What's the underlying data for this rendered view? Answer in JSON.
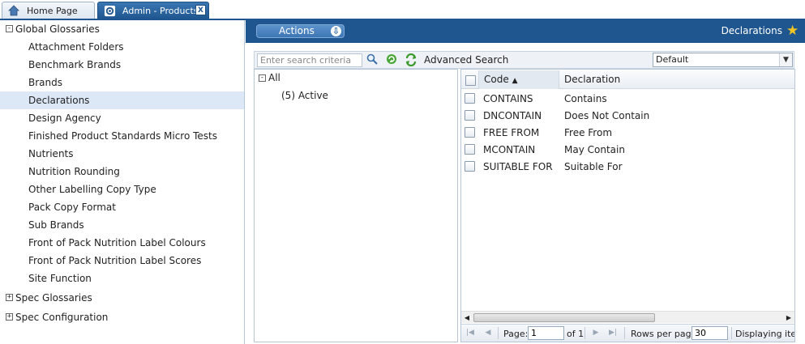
{
  "tabs": [
    {
      "label": "Home Page"
    },
    {
      "label": "Admin - Products",
      "close": "X"
    }
  ],
  "left_tree": {
    "groups": [
      {
        "label": "Global Glossaries",
        "toggle": "-",
        "items": [
          "Attachment Folders",
          "Benchmark Brands",
          "Brands",
          "Declarations",
          "Design Agency",
          "Finished Product Standards Micro Tests",
          "Nutrients",
          "Nutrition Rounding",
          "Other Labelling Copy Type",
          "Pack Copy Format",
          "Sub Brands",
          "Front of Pack Nutrition Label Colours",
          "Front of Pack Nutrition Label Scores",
          "Site Function"
        ],
        "selected": "Declarations"
      },
      {
        "label": "Spec Glossaries",
        "toggle": "+"
      },
      {
        "label": "Spec Configuration",
        "toggle": "+"
      }
    ]
  },
  "header": {
    "actions_label": "Actions",
    "title": "Declarations",
    "title_icon": "star-icon"
  },
  "search": {
    "placeholder": "Enter search criteria",
    "advanced_label": "Advanced Search",
    "view": "Default"
  },
  "filter_tree": {
    "root": "All",
    "root_toggle": "-",
    "children": [
      "(5) Active"
    ]
  },
  "grid": {
    "columns": [
      "Code",
      "Declaration"
    ],
    "sort_indicator": "▲",
    "rows": [
      {
        "code": "CONTAINS",
        "declaration": "Contains"
      },
      {
        "code": "DNCONTAIN",
        "declaration": "Does Not Contain"
      },
      {
        "code": "FREE FROM",
        "declaration": "Free From"
      },
      {
        "code": "MCONTAIN",
        "declaration": "May Contain"
      },
      {
        "code": "SUITABLE FOR",
        "declaration": "Suitable For"
      }
    ]
  },
  "pager": {
    "page_label": "Page:",
    "page": "1",
    "of_label": "of 1",
    "rows_label": "Rows per page",
    "rows_per_page": "30",
    "displaying": "Displaying items"
  },
  "colors": {
    "header_blue": "#1f5690",
    "selected_row": "#dce8f6",
    "accent_green": "#3a9a2a"
  }
}
